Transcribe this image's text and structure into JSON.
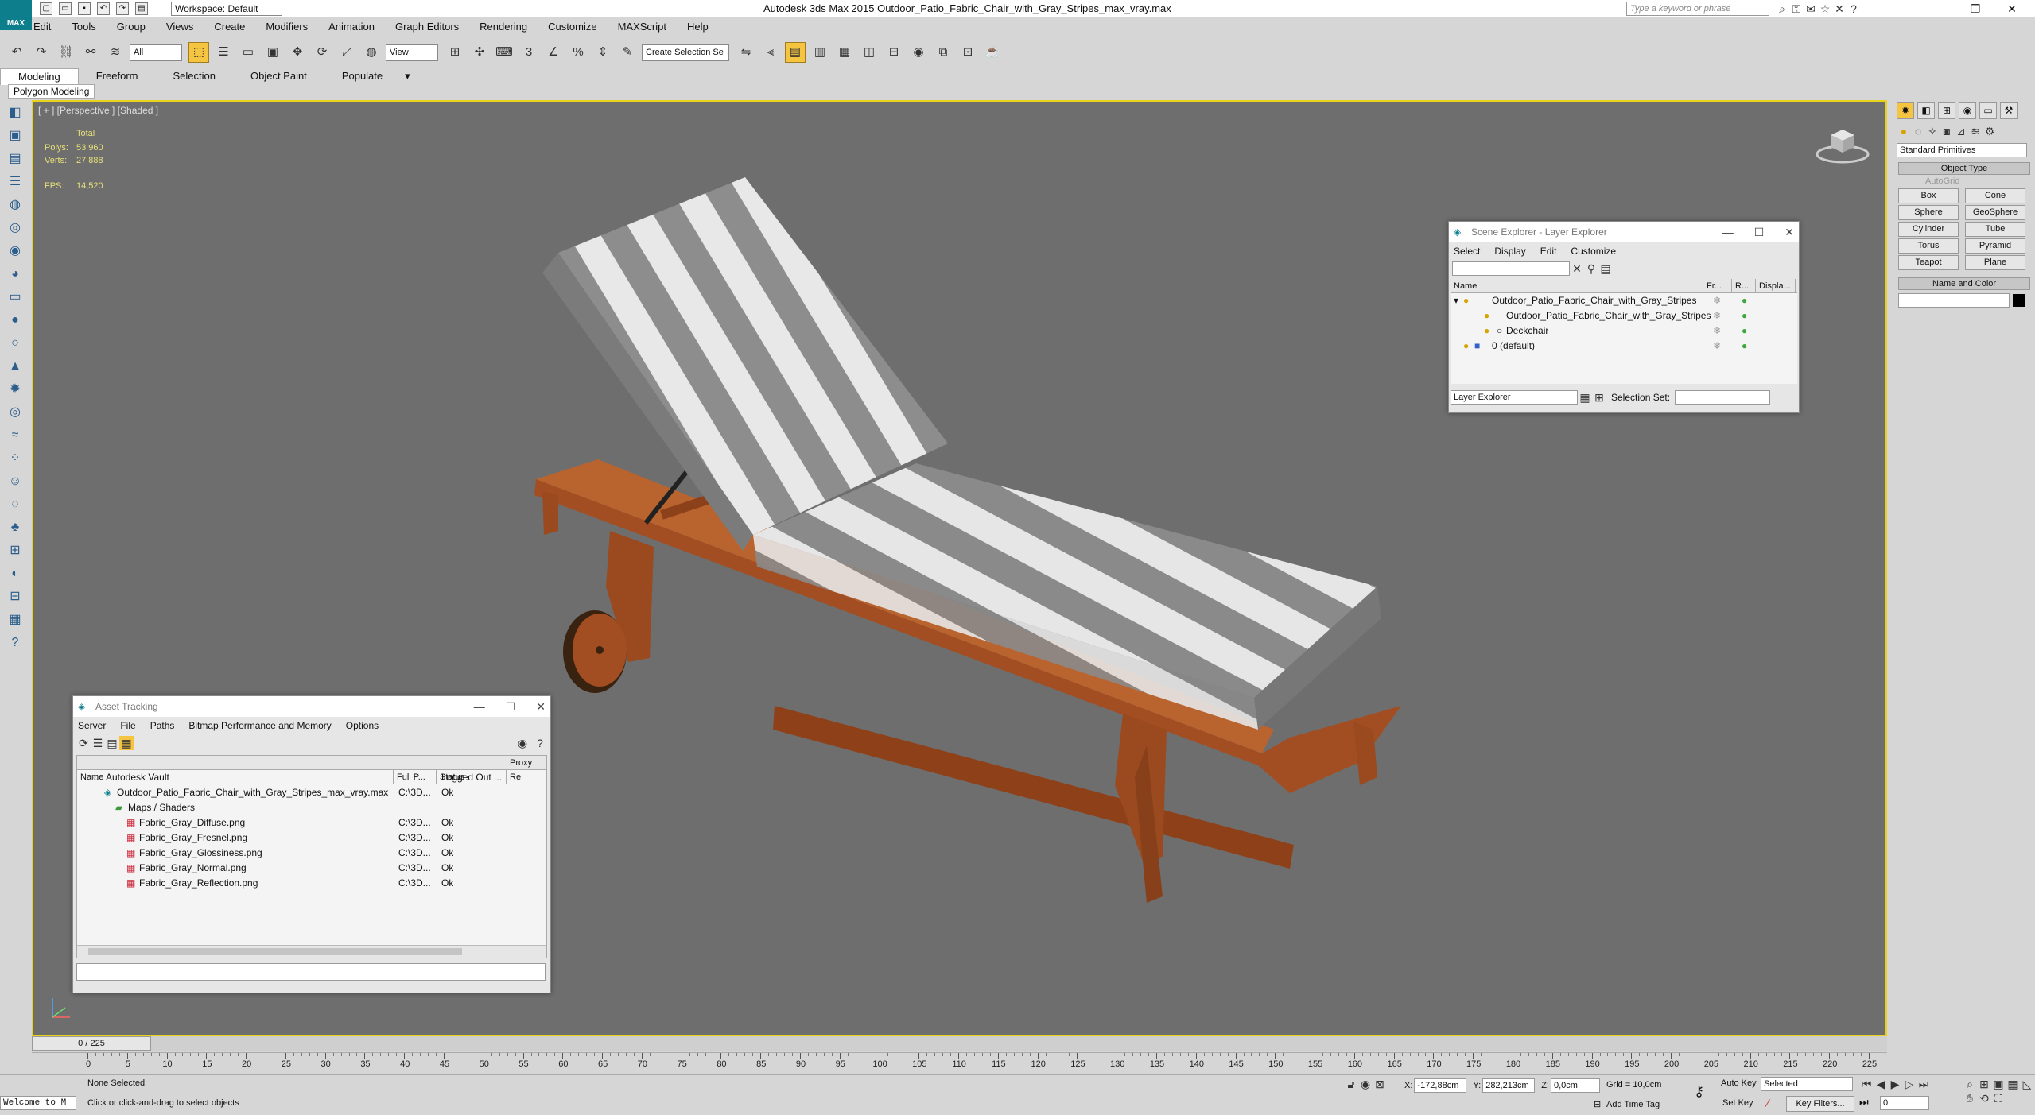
{
  "titlebar": {
    "app_logo": "MAX",
    "workspace": "Workspace: Default",
    "title": "Autodesk 3ds Max  2015    Outdoor_Patio_Fabric_Chair_with_Gray_Stripes_max_vray.max",
    "search_placeholder": "Type a keyword or phrase"
  },
  "menu": [
    "Edit",
    "Tools",
    "Group",
    "Views",
    "Create",
    "Modifiers",
    "Animation",
    "Graph Editors",
    "Rendering",
    "Customize",
    "MAXScript",
    "Help"
  ],
  "toolbar": {
    "filter": "All",
    "refcoord": "View",
    "selection_set": "Create Selection Se"
  },
  "ribbon": {
    "tabs": [
      "Modeling",
      "Freeform",
      "Selection",
      "Object Paint",
      "Populate"
    ],
    "sub": "Polygon Modeling"
  },
  "viewport": {
    "label": "[ + ] [Perspective ] [Shaded ]",
    "total_label": "Total",
    "polys_label": "Polys:",
    "polys_value": "53 960",
    "verts_label": "Verts:",
    "verts_value": "27 888",
    "fps_label": "FPS:",
    "fps_value": "14,520"
  },
  "command_panel": {
    "category": "Standard Primitives",
    "object_type": "Object Type",
    "autogrid": "AutoGrid",
    "buttons": [
      "Box",
      "Cone",
      "Sphere",
      "GeoSphere",
      "Cylinder",
      "Tube",
      "Torus",
      "Pyramid",
      "Teapot",
      "Plane"
    ],
    "name_color": "Name and Color"
  },
  "scene_explorer": {
    "title": "Scene Explorer - Layer Explorer",
    "menu": [
      "Select",
      "Display",
      "Edit",
      "Customize"
    ],
    "columns": [
      "Name",
      "Fr...",
      "R...",
      "Displa..."
    ],
    "rows": [
      "Outdoor_Patio_Fabric_Chair_with_Gray_Stripes",
      "Outdoor_Patio_Fabric_Chair_with_Gray_Stripes",
      "Deckchair",
      "0 (default)"
    ],
    "footer_mode": "Layer Explorer",
    "selection_set_label": "Selection Set:"
  },
  "asset_tracking": {
    "title": "Asset Tracking",
    "menu": [
      "Server",
      "File",
      "Paths",
      "Bitmap Performance and Memory",
      "Options"
    ],
    "columns": [
      "Name",
      "Full P...",
      "Status",
      "Proxy Re"
    ],
    "rows": [
      {
        "name": "Autodesk Vault",
        "path": "",
        "status": "Logged Out ..."
      },
      {
        "name": "Outdoor_Patio_Fabric_Chair_with_Gray_Stripes_max_vray.max",
        "path": "C:\\3D...",
        "status": "Ok"
      },
      {
        "name": "Maps / Shaders",
        "path": "",
        "status": ""
      },
      {
        "name": "Fabric_Gray_Diffuse.png",
        "path": "C:\\3D...",
        "status": "Ok"
      },
      {
        "name": "Fabric_Gray_Fresnel.png",
        "path": "C:\\3D...",
        "status": "Ok"
      },
      {
        "name": "Fabric_Gray_Glossiness.png",
        "path": "C:\\3D...",
        "status": "Ok"
      },
      {
        "name": "Fabric_Gray_Normal.png",
        "path": "C:\\3D...",
        "status": "Ok"
      },
      {
        "name": "Fabric_Gray_Reflection.png",
        "path": "C:\\3D...",
        "status": "Ok"
      }
    ]
  },
  "timeline": {
    "frame": "0 / 225",
    "ticks": [
      "0",
      "5",
      "10",
      "15",
      "20",
      "25",
      "30",
      "35",
      "40",
      "45",
      "50",
      "55",
      "60",
      "65",
      "70",
      "75",
      "80",
      "85",
      "90",
      "95",
      "100",
      "105",
      "110",
      "115",
      "120",
      "125",
      "130",
      "135",
      "140",
      "145",
      "150",
      "155",
      "160",
      "165",
      "170",
      "175",
      "180",
      "185",
      "190",
      "195",
      "200",
      "205",
      "210",
      "215",
      "220",
      "225"
    ]
  },
  "status": {
    "maxscript": "Welcome to M",
    "selected": "None Selected",
    "prompt": "Click or click-and-drag to select objects",
    "x_label": "X:",
    "x": "-172,88cm",
    "y_label": "Y:",
    "y": "282,213cm",
    "z_label": "Z:",
    "z": "0,0cm",
    "grid": "Grid = 10,0cm",
    "autokey": "Auto Key",
    "setkey": "Set Key",
    "selected_mode": "Selected",
    "key_filters": "Key Filters...",
    "addtimetag": "Add Time Tag",
    "current_frame": "0"
  },
  "colors": {
    "viewport_border": "#e8d21c",
    "viewport_bg": "#6e6e6e",
    "wood": "#b0592a",
    "stripe_gray": "#8c8c8c",
    "stripe_white": "#e6e6e6"
  }
}
